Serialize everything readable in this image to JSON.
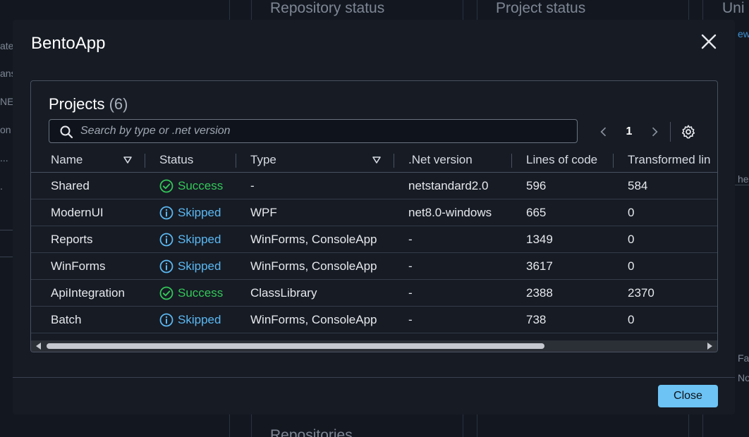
{
  "background": {
    "headers": [
      "Repository status",
      "Project status",
      "Uni"
    ],
    "fragments": [
      "ate",
      "ansf",
      "NET",
      "on",
      "...",
      ".",
      "he",
      "Fa",
      "No",
      "ew"
    ],
    "bottom_heading": "Repositories"
  },
  "modal": {
    "title": "BentoApp",
    "close_label": "Close"
  },
  "projects": {
    "title": "Projects",
    "count": "(6)",
    "search_placeholder": "Search by type or .net version",
    "page": "1",
    "columns": [
      "Name",
      "Status",
      "Type",
      ".Net version",
      "Lines of code",
      "Transformed lin"
    ],
    "rows": [
      {
        "name": "Shared",
        "status": "Success",
        "type": "-",
        "net": "netstandard2.0",
        "loc": "596",
        "transformed": "584"
      },
      {
        "name": "ModernUI",
        "status": "Skipped",
        "type": "WPF",
        "net": "net8.0-windows",
        "loc": "665",
        "transformed": "0"
      },
      {
        "name": "Reports",
        "status": "Skipped",
        "type": "WinForms, ConsoleApp",
        "net": "-",
        "loc": "1349",
        "transformed": "0"
      },
      {
        "name": "WinForms",
        "status": "Skipped",
        "type": "WinForms, ConsoleApp",
        "net": "-",
        "loc": "3617",
        "transformed": "0"
      },
      {
        "name": "ApiIntegration",
        "status": "Success",
        "type": "ClassLibrary",
        "net": "-",
        "loc": "2388",
        "transformed": "2370"
      },
      {
        "name": "Batch",
        "status": "Skipped",
        "type": "WinForms, ConsoleApp",
        "net": "-",
        "loc": "738",
        "transformed": "0"
      }
    ]
  },
  "colors": {
    "success": "#34c759",
    "skipped": "#5cb8f2",
    "primary_button": "#6cc3f4"
  }
}
